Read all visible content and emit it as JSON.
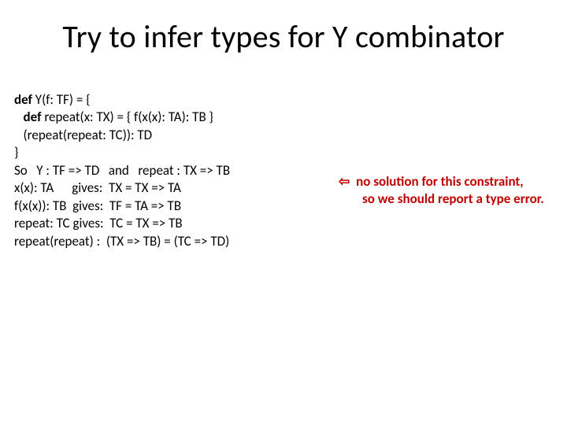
{
  "title": "Try to infer types for Y combinator",
  "code": {
    "l1_kw": "def ",
    "l1_rest": "Y(f: TF) = {",
    "l2_kw": "   def ",
    "l2_rest": "repeat(x: TX) = { f(x(x): TA): TB }",
    "l3": "   (repeat(repeat: TC)): TD",
    "l4": "}",
    "l5": "So   Y : TF => TD   and   repeat : TX => TB",
    "l6": "x(x): TA      gives:  TX = TX => TA",
    "l7": "f(x(x)): TB  gives:  TF = TA => TB",
    "l8": "repeat: TC gives:  TC = TX => TB",
    "l9": "repeat(repeat) :  (TX => TB) = (TC => TD)"
  },
  "note": {
    "arrow": "⇦",
    "line1": " no solution for this constraint,",
    "line2": "so we should report a type error."
  }
}
